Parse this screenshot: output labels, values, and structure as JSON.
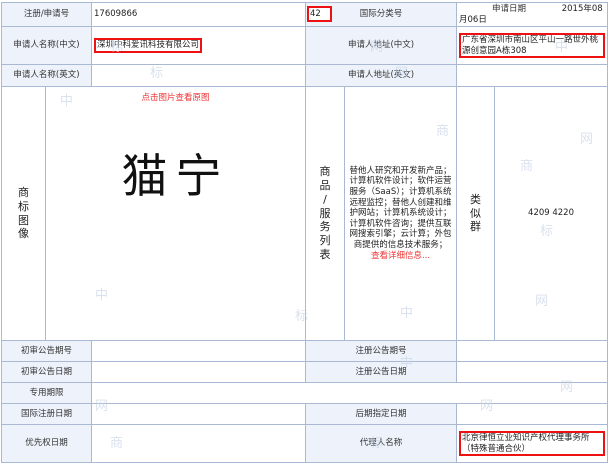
{
  "rows": {
    "reg_no_label": "注册/申请号",
    "reg_no_value": "17609866",
    "intl_class_label": "国际分类号",
    "intl_class_value": "42",
    "app_date_label": "申请日期",
    "app_date_value": "2015年08月06日",
    "applicant_cn_label": "申请人名称(中文)",
    "applicant_cn_value": "深圳中科爱讯科技有限公司",
    "address_cn_label": "申请人地址(中文)",
    "address_cn_value": "广东省深圳市南山区平山一路世外桃源创意园A栋308",
    "applicant_en_label": "申请人名称(英文)",
    "applicant_en_value": "",
    "address_en_label": "申请人地址(英文)",
    "address_en_value": ""
  },
  "mark": {
    "side_label": [
      "商",
      "标",
      "图",
      "像"
    ],
    "view_image_link": "点击图片查看原图",
    "text": "猫宁"
  },
  "services": {
    "side_label": [
      "商",
      "品",
      "/",
      "服",
      "务",
      "列",
      "表"
    ],
    "text": "替他人研究和开发新产品；计算机软件设计；软件运营服务（SaaS）；计算机系统远程监控；替他人创建和维护网站；计算机系统设计；计算机软件咨询；提供互联网搜索引擎；云计算；外包商提供的信息技术服务；",
    "more_link": "查看详细信息..."
  },
  "similar_group": {
    "side_label": [
      "类",
      "似",
      "群"
    ],
    "value": "4209   4220"
  },
  "bottom": {
    "prelim_no_label": "初审公告期号",
    "prelim_no_value": "",
    "reg_pub_no_label": "注册公告期号",
    "reg_pub_no_value": "",
    "prelim_date_label": "初审公告日期",
    "prelim_date_value": "",
    "reg_pub_date_label": "注册公告日期",
    "reg_pub_date_value": "",
    "exclusive_label": "专用期限",
    "exclusive_value": "",
    "intl_reg_date_label": "国际注册日期",
    "intl_reg_date_value": "",
    "later_date_label": "后期指定日期",
    "later_date_value": "",
    "priority_date_label": "优先权日期",
    "priority_date_value": "",
    "agent_label": "代理人名称",
    "agent_value": "北京律恒立业知识产权代理事务所（特殊普通合伙）"
  },
  "watermarks": [
    "中",
    "商",
    "标",
    "网",
    "中",
    "商",
    "标",
    "网",
    "中",
    "商",
    "标",
    "网",
    "中",
    "商",
    "标",
    "网"
  ]
}
